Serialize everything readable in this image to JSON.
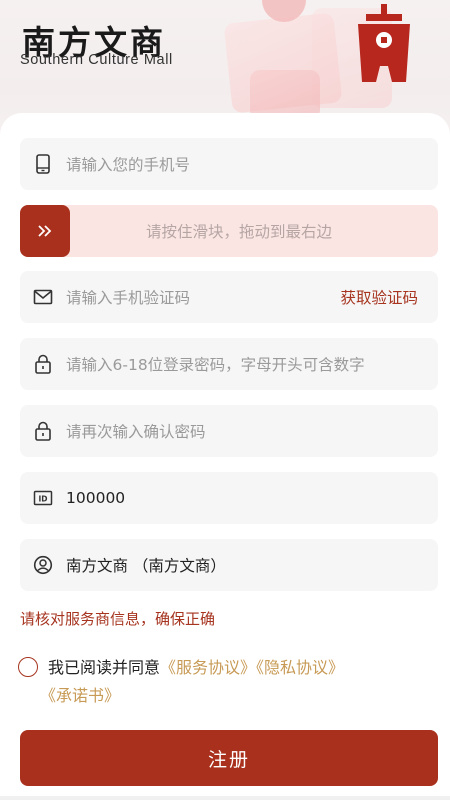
{
  "brand": {
    "title_cn": "南方文商",
    "title_en": "Southern Culture Mall"
  },
  "colors": {
    "accent": "#a8301c",
    "link": "#c79a55",
    "field_bg": "#f6f6f6",
    "slider_bg": "#fbe5e3"
  },
  "form": {
    "phone": {
      "placeholder": "请输入您的手机号",
      "icon": "phone-icon"
    },
    "slider": {
      "text": "请按住滑块，拖动到最右边",
      "icon": "double-chevron-right-icon"
    },
    "sms_code": {
      "placeholder": "请输入手机验证码",
      "button": "获取验证码",
      "icon": "mail-icon"
    },
    "password": {
      "placeholder": "请输入6-18位登录密码，字母开头可含数字",
      "icon": "lock-icon"
    },
    "confirm_password": {
      "placeholder": "请再次输入确认密码",
      "icon": "lock-icon"
    },
    "merchant_id": {
      "value": "100000",
      "icon": "id-card-icon"
    },
    "merchant_name": {
      "value": "南方文商 （南方文商）",
      "icon": "user-circle-icon"
    }
  },
  "notice": "请核对服务商信息，确保正确",
  "agreement": {
    "prefix": "我已阅读并同意",
    "service": "《服务协议》",
    "privacy": "《隐私协议》",
    "commitment": "《承诺书》"
  },
  "register_label": "注册"
}
